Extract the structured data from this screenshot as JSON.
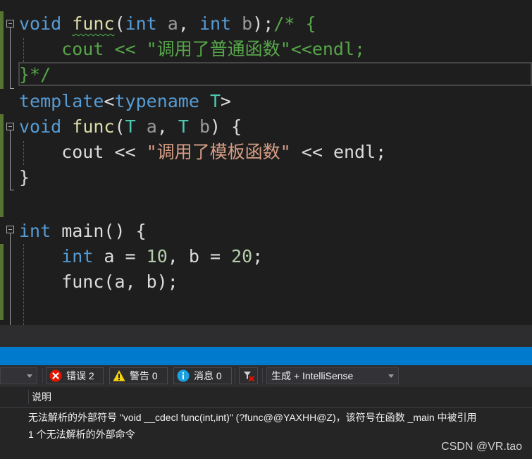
{
  "editor": {
    "lines": [
      [
        {
          "t": "void",
          "c": "kw"
        },
        {
          "t": " ",
          "c": "tx"
        },
        {
          "t": "func",
          "c": "fn",
          "sq": true
        },
        {
          "t": "(",
          "c": "tx"
        },
        {
          "t": "int",
          "c": "kw"
        },
        {
          "t": " ",
          "c": "tx"
        },
        {
          "t": "a",
          "c": "pa"
        },
        {
          "t": ", ",
          "c": "tx"
        },
        {
          "t": "int",
          "c": "kw"
        },
        {
          "t": " ",
          "c": "tx"
        },
        {
          "t": "b",
          "c": "pa"
        },
        {
          "t": ");",
          "c": "tx"
        },
        {
          "t": "/* {",
          "c": "cm"
        }
      ],
      [
        {
          "t": "    cout << \"调用了普通函数\"<<endl;",
          "c": "cm"
        }
      ],
      [
        {
          "t": "}*/",
          "c": "cm"
        }
      ],
      [
        {
          "t": "template",
          "c": "kw"
        },
        {
          "t": "<",
          "c": "tx"
        },
        {
          "t": "typename",
          "c": "kw"
        },
        {
          "t": " ",
          "c": "tx"
        },
        {
          "t": "T",
          "c": "tp"
        },
        {
          "t": ">",
          "c": "tx"
        }
      ],
      [
        {
          "t": "void",
          "c": "kw"
        },
        {
          "t": " ",
          "c": "tx"
        },
        {
          "t": "func",
          "c": "fn"
        },
        {
          "t": "(",
          "c": "tx"
        },
        {
          "t": "T",
          "c": "tp"
        },
        {
          "t": " ",
          "c": "tx"
        },
        {
          "t": "a",
          "c": "pa"
        },
        {
          "t": ", ",
          "c": "tx"
        },
        {
          "t": "T",
          "c": "tp"
        },
        {
          "t": " ",
          "c": "tx"
        },
        {
          "t": "b",
          "c": "pa"
        },
        {
          "t": ") {",
          "c": "tx"
        }
      ],
      [
        {
          "t": "    cout << ",
          "c": "tx"
        },
        {
          "t": "\"调用了模板函数\"",
          "c": "st"
        },
        {
          "t": " << endl;",
          "c": "tx"
        }
      ],
      [
        {
          "t": "}",
          "c": "tx"
        }
      ],
      [],
      [
        {
          "t": "int",
          "c": "kw"
        },
        {
          "t": " main() {",
          "c": "tx"
        }
      ],
      [
        {
          "t": "    ",
          "c": "tx"
        },
        {
          "t": "int",
          "c": "kw"
        },
        {
          "t": " a = ",
          "c": "tx"
        },
        {
          "t": "10",
          "c": "nm"
        },
        {
          "t": ", b = ",
          "c": "tx"
        },
        {
          "t": "20",
          "c": "nm"
        },
        {
          "t": ";",
          "c": "tx"
        }
      ],
      [
        {
          "t": "    func(a, b);",
          "c": "tx"
        }
      ]
    ]
  },
  "error_list": {
    "scope_combo": "",
    "errors": {
      "label": "错误 2",
      "icon": "error-icon",
      "color": "#e51400"
    },
    "warnings": {
      "label": "警告 0",
      "icon": "warning-icon",
      "color": "#f8d40e"
    },
    "messages": {
      "label": "消息 0",
      "icon": "info-icon",
      "color": "#1ba1e2"
    },
    "filter_icon": "filter-icon",
    "build_combo": "生成 + IntelliSense",
    "column_header": "说明",
    "rows": [
      "无法解析的外部符号 \"void __cdecl func(int,int)\" (?func@@YAXHH@Z)，该符号在函数 _main 中被引用",
      "1 个无法解析的外部命令"
    ]
  },
  "watermark": "CSDN @VR.tao"
}
